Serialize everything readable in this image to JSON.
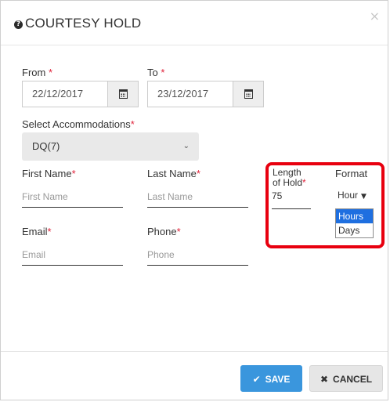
{
  "header": {
    "title": "COURTESY HOLD",
    "help_icon": "?",
    "close_icon": "×"
  },
  "dates": {
    "from_label": "From",
    "to_label": "To",
    "required_mark": "*",
    "from_value": "22/12/2017",
    "to_value": "23/12/2017"
  },
  "accommodations": {
    "label": "Select Accommodations",
    "value": "DQ(7)"
  },
  "fields": {
    "first_name": {
      "label": "First Name",
      "placeholder": "First Name"
    },
    "last_name": {
      "label": "Last Name",
      "placeholder": "Last Name"
    },
    "email": {
      "label": "Email",
      "placeholder": "Email"
    },
    "phone": {
      "label": "Phone",
      "placeholder": "Phone"
    }
  },
  "hold": {
    "length_label_line1": "Length",
    "length_label_line2": "of Hold",
    "length_value": "75",
    "format_label": "Format",
    "format_value": "Hour",
    "format_options": [
      "Hours",
      "Days"
    ]
  },
  "footer": {
    "save_label": "SAVE",
    "cancel_label": "CANCEL"
  },
  "colors": {
    "accent": "#3a96dd",
    "highlight": "#e8000f",
    "required": "#e0233b",
    "selected_option": "#1e6fe0"
  }
}
